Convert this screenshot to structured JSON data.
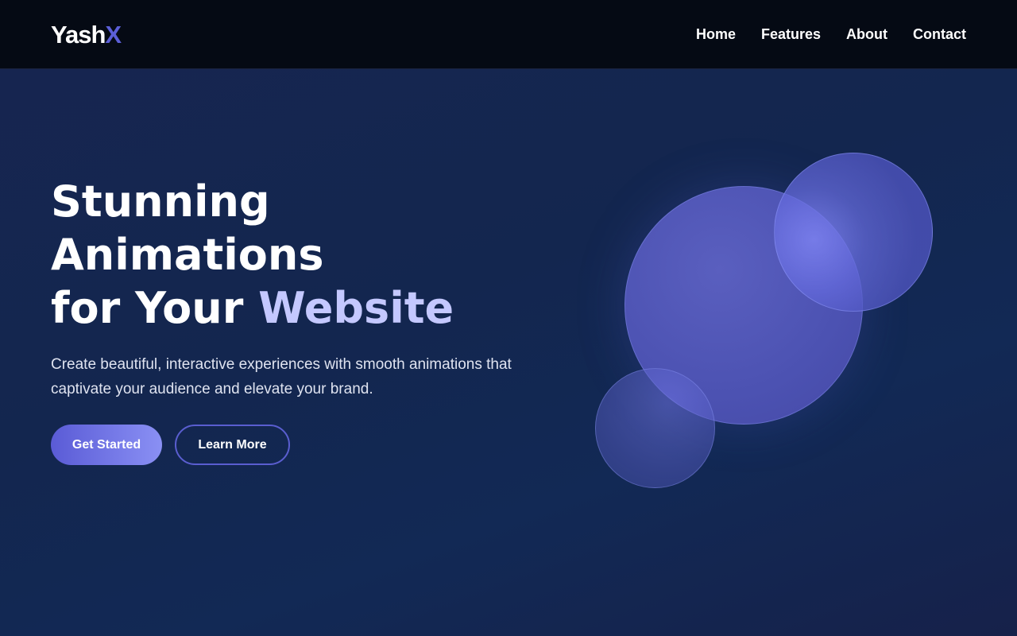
{
  "header": {
    "logo_main": "Yash",
    "logo_accent": "X",
    "nav": [
      {
        "label": "Home"
      },
      {
        "label": "Features"
      },
      {
        "label": "About"
      },
      {
        "label": "Contact"
      }
    ]
  },
  "hero": {
    "title_line1": "Stunning",
    "title_line2": "Animations",
    "title_line3_start": "for Your ",
    "title_line3_highlight": "Website",
    "description": "Create beautiful, interactive experiences with smooth animations that captivate your audience and elevate your brand.",
    "primary_button": "Get Started",
    "secondary_button": "Learn More"
  },
  "colors": {
    "accent": "#5b5fd8",
    "highlight": "#c4c8ff",
    "background": "#13264f",
    "navbar": "#050a14"
  }
}
